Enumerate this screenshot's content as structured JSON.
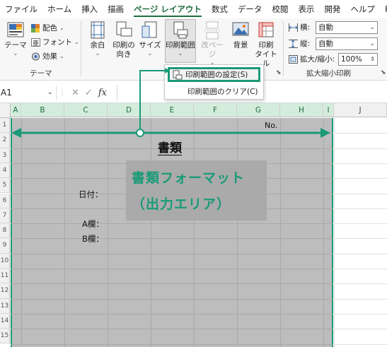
{
  "menu": {
    "tabs": [
      "ファイル",
      "ホーム",
      "挿入",
      "描画",
      "ページ レイアウト",
      "数式",
      "データ",
      "校閲",
      "表示",
      "開発",
      "ヘルプ",
      "Power Pi"
    ],
    "active_index": 4
  },
  "ribbon": {
    "theme": {
      "label": "テーマ",
      "colors": "配色",
      "fonts": "フォント",
      "effects": "効果",
      "group_label": "テーマ"
    },
    "page_setup": {
      "margins": "余白",
      "orientation_line1": "印刷の",
      "orientation_line2": "向き",
      "size": "サイズ",
      "print_area": "印刷範囲",
      "breaks": "改ページ",
      "background": "背景",
      "titles_line1": "印刷",
      "titles_line2": "タイトル"
    },
    "scale": {
      "width_label": "横:",
      "width_value": "自動",
      "height_label": "縦:",
      "height_value": "自動",
      "zoom_label": "拡大/縮小:",
      "zoom_value": "100%",
      "group_label": "拡大縮小印刷"
    }
  },
  "dropdown": {
    "set_print_area": "印刷範囲の設定(S)",
    "clear_print_area": "印刷範囲のクリア(C)"
  },
  "formula_bar": {
    "name_box": "A1",
    "cancel": "✕",
    "enter": "✓",
    "fx": "fx",
    "value": ""
  },
  "sheet": {
    "columns": [
      "A",
      "B",
      "C",
      "D",
      "E",
      "F",
      "G",
      "H",
      "I",
      "J"
    ],
    "rows": [
      "1",
      "2",
      "3",
      "4",
      "5",
      "6",
      "7",
      "8",
      "9",
      "10",
      "11",
      "12",
      "13",
      "14",
      "15"
    ],
    "cells": {
      "no_label": "No.",
      "title": "書類",
      "date_label": "日付：",
      "a_label": "A欄：",
      "b_label": "B欄："
    },
    "annotation_line1": "書類フォーマット",
    "annotation_line2": "（出力エリア）"
  },
  "colors": {
    "accent": "#1a9a78",
    "tab_active": "#1e6e3c",
    "print_area_fill": "#bdbdbd",
    "selected_header": "#d4ecdc"
  }
}
